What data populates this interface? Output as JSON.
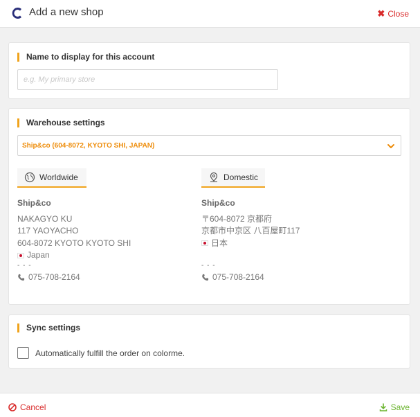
{
  "header": {
    "title": "Add a new shop",
    "close_label": "Close"
  },
  "name_section": {
    "title": "Name to display for this account",
    "placeholder": "e.g. My primary store",
    "value": ""
  },
  "warehouse": {
    "title": "Warehouse settings",
    "selected": "Ship&co (604-8072, KYOTO SHI, JAPAN)",
    "tabs": {
      "worldwide": "Worldwide",
      "domestic": "Domestic"
    },
    "worldwide": {
      "company": "Ship&co",
      "line1": "NAKAGYO KU",
      "line2": "117 YAOYACHO",
      "line3": "604-8072 KYOTO KYOTO SHI",
      "country": "Japan",
      "dots": "- - -",
      "phone": "075-708-2164"
    },
    "domestic": {
      "company": "Ship&co",
      "line1": "〒604-8072 京都府",
      "line2": "京都市中京区 八百屋町117",
      "country": "日本",
      "dots": "- - -",
      "phone": "075-708-2164"
    }
  },
  "sync": {
    "title": "Sync settings",
    "checkbox_label": "Automatically fulfill the order on colorme.",
    "checked": false
  },
  "footer": {
    "cancel_label": "Cancel",
    "save_label": "Save"
  },
  "colors": {
    "accent": "#f0a31b",
    "select_text": "#ee8d0b",
    "danger": "#d92b2b",
    "success": "#6ab42d",
    "logo": "#2a2f7a"
  },
  "icons": {
    "logo": "shipandco-logo",
    "close": "close-icon",
    "chevron": "chevron-down-icon",
    "worldwide": "globe-icon",
    "domestic": "map-pin-icon",
    "phone": "phone-icon",
    "flag": "japan-flag-icon",
    "cancel": "ban-icon",
    "save": "download-icon"
  }
}
